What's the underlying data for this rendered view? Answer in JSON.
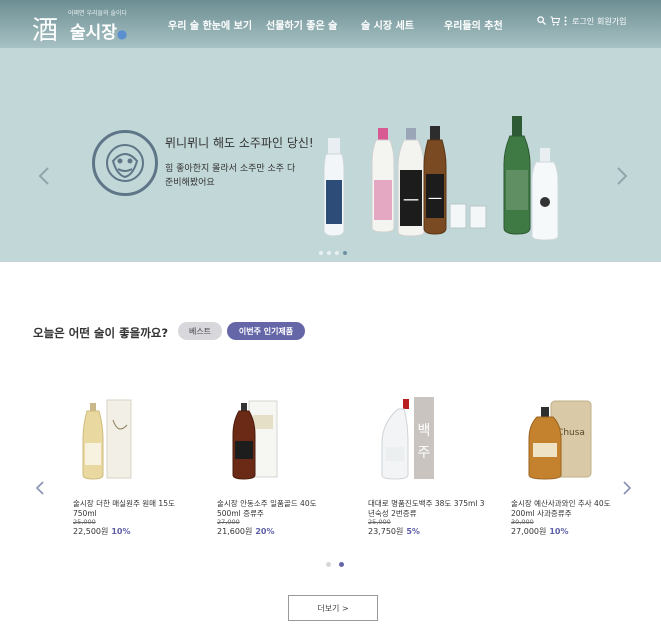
{
  "header": {
    "logo_tagline": "어쩌면 우리들의 술이다",
    "logo_text": "술시장",
    "nav": [
      "우리 술 한눈에 보기",
      "선물하기 좋은 술",
      "술 시장 세트",
      "우리들의 추천"
    ],
    "login": "로그인",
    "signup": "회원가입"
  },
  "hero": {
    "title": "뮈니뮈니 해도 소주파인 당신!",
    "subtitle": "힘 좋아한지 몰라서 소주만 소주 다 준비해봤어요",
    "slide_count": 4,
    "active_slide": 4
  },
  "section": {
    "title": "오늘은 어떤 술이 좋을까요?",
    "pill_best": "베스트",
    "pill_month": "이번주 인기제품"
  },
  "products": [
    {
      "name": "술시장 더한 매실원주 원매 15도 750ml",
      "original_price": "25,000",
      "price": "22,500원",
      "discount": "10%"
    },
    {
      "name": "술시장 안동소주 일품골드 40도 500ml 증류주",
      "original_price": "27,000",
      "price": "21,600원",
      "discount": "20%"
    },
    {
      "name": "대대로 명품진도백주 38도 375ml 3년숙성 2번증류",
      "original_price": "25,000",
      "price": "23,750원",
      "discount": "5%"
    },
    {
      "name": "술시장 예산사과와인 추사 40도 200ml 사과증류주",
      "original_price": "30,000",
      "price": "27,000원",
      "discount": "10%"
    }
  ],
  "product_pages": 2,
  "active_product_page": 2,
  "more_button": "더보기 >",
  "colors": {
    "header_top": "#6d8f94",
    "hero_bg": "#c2d7d7",
    "accent": "#6566a8",
    "discount": "#5d5fa6"
  },
  "icons": [
    "search-icon",
    "cart-icon",
    "menu-icon",
    "chevron-left-icon",
    "chevron-right-icon",
    "tiger-emblem-icon"
  ]
}
